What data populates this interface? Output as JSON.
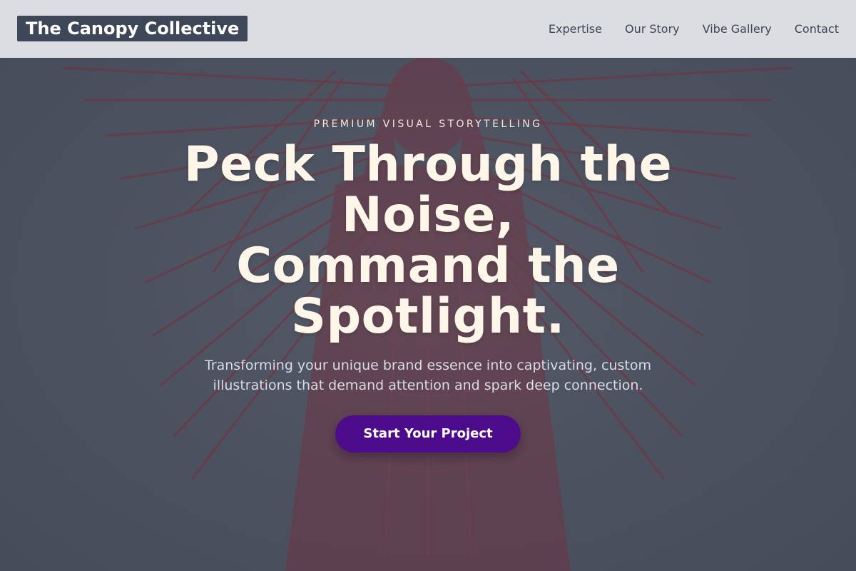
{
  "header": {
    "brand": "The Canopy Collective",
    "nav": [
      {
        "label": "Expertise"
      },
      {
        "label": "Our Story"
      },
      {
        "label": "Vibe Gallery"
      },
      {
        "label": "Contact"
      }
    ]
  },
  "hero": {
    "eyebrow": "PREMIUM VISUAL STORYTELLING",
    "headline_line1": "Peck Through the",
    "headline_line2": "Noise,",
    "headline_line3": "Command the",
    "headline_line4": "Spotlight.",
    "subtext": "Transforming your unique brand essence into captivating, custom illustrations that demand attention and spark deep connection.",
    "cta_label": "Start Your Project",
    "background_art": "engraved-winged-figure-illustration"
  },
  "colors": {
    "header_bg": "#dcdde0",
    "brand_bg": "#3e4758",
    "hero_overlay": "#4a505e",
    "headline": "#fff6ea",
    "cta_bg": "#4b0b8a",
    "art_tint": "#7a2c3c"
  }
}
